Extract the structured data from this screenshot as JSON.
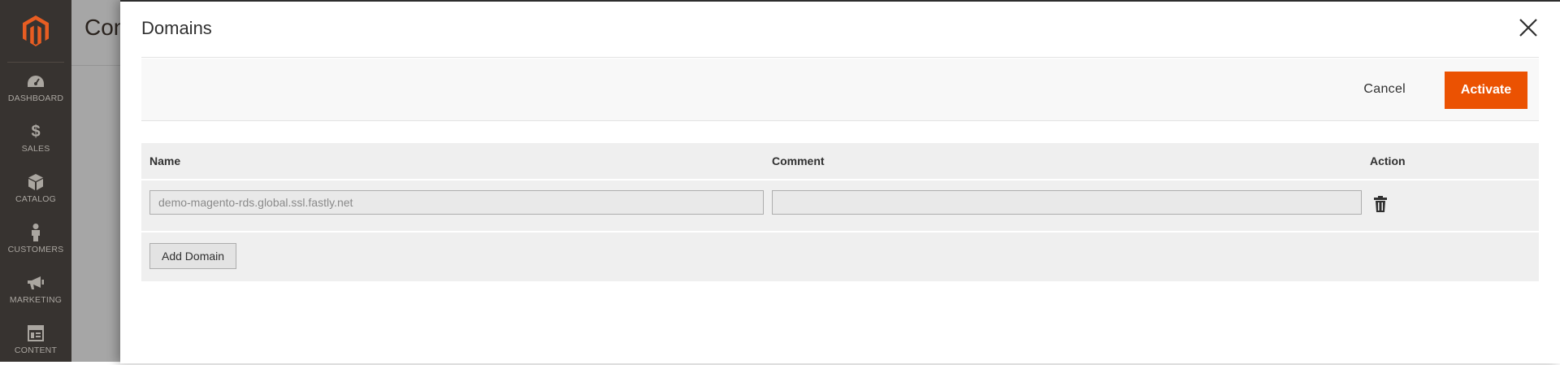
{
  "sidebar": {
    "items": [
      {
        "label": "DASHBOARD",
        "icon": "dashboard-icon"
      },
      {
        "label": "SALES",
        "icon": "dollar-icon"
      },
      {
        "label": "CATALOG",
        "icon": "box-icon"
      },
      {
        "label": "CUSTOMERS",
        "icon": "person-icon"
      },
      {
        "label": "MARKETING",
        "icon": "megaphone-icon"
      },
      {
        "label": "CONTENT",
        "icon": "layout-icon"
      }
    ]
  },
  "background_page": {
    "title_fragment": "Con"
  },
  "modal": {
    "title": "Domains",
    "cancel_label": "Cancel",
    "activate_label": "Activate",
    "columns": {
      "name": "Name",
      "comment": "Comment",
      "action": "Action"
    },
    "rows": [
      {
        "name_value": "demo-magento-rds.global.ssl.fastly.net",
        "comment_value": ""
      }
    ],
    "add_domain_label": "Add Domain"
  },
  "colors": {
    "accent": "#eb5202",
    "sidebar_bg": "#373330",
    "logo": "#e85d22"
  }
}
